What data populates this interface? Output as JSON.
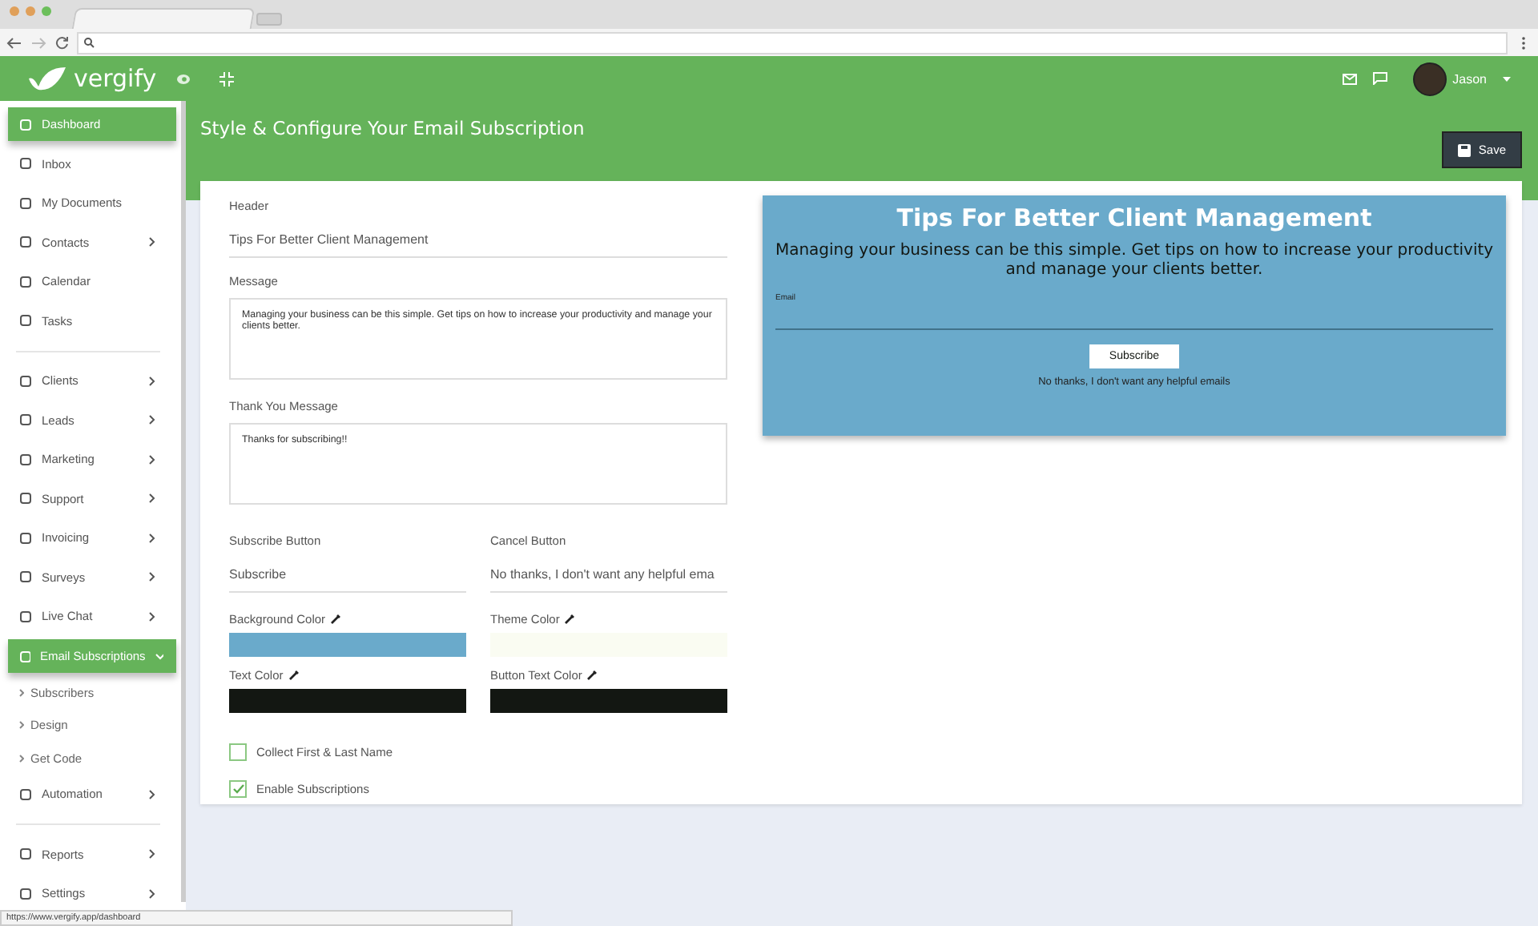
{
  "app": {
    "brand": "vergify",
    "user": "Jason"
  },
  "sidebar": {
    "sections": [
      {
        "items": [
          {
            "label": "Dashboard",
            "selected": true,
            "has_submenu": false
          },
          {
            "label": "Inbox",
            "selected": false,
            "has_submenu": false
          },
          {
            "label": "My Documents",
            "selected": false,
            "has_submenu": false
          },
          {
            "label": "Contacts",
            "selected": false,
            "has_submenu": true
          },
          {
            "label": "Calendar",
            "selected": false,
            "has_submenu": false
          },
          {
            "label": "Tasks",
            "selected": false,
            "has_submenu": false
          }
        ]
      },
      {
        "items": [
          {
            "label": "Clients",
            "selected": false,
            "has_submenu": true
          },
          {
            "label": "Leads",
            "selected": false,
            "has_submenu": true
          },
          {
            "label": "Marketing",
            "selected": false,
            "has_submenu": true
          },
          {
            "label": "Support",
            "selected": false,
            "has_submenu": true
          },
          {
            "label": "Invoicing",
            "selected": false,
            "has_submenu": true
          },
          {
            "label": "Surveys",
            "selected": false,
            "has_submenu": true
          },
          {
            "label": "Live Chat",
            "selected": false,
            "has_submenu": true
          },
          {
            "label": "Email Subscriptions",
            "selected": true,
            "has_submenu": true,
            "expanded": true,
            "children": [
              {
                "label": "Subscribers"
              },
              {
                "label": "Design"
              },
              {
                "label": "Get Code"
              }
            ]
          },
          {
            "label": "Automation",
            "selected": false,
            "has_submenu": true
          }
        ]
      },
      {
        "items": [
          {
            "label": "Reports",
            "selected": false,
            "has_submenu": true
          },
          {
            "label": "Settings",
            "selected": false,
            "has_submenu": true
          }
        ]
      }
    ]
  },
  "page": {
    "title": "Style & Configure Your Email Subscription",
    "save_button": "Save"
  },
  "form": {
    "header": {
      "label": "Header",
      "value": "Tips For Better Client Management"
    },
    "message": {
      "label": "Message",
      "value": "Managing your business can be this simple. Get tips on how to increase your productivity and manage your clients better."
    },
    "thank_you": {
      "label": "Thank You Message",
      "value": "Thanks for subscribing!!"
    },
    "buttons": [
      {
        "label": "Subscribe Button",
        "value": "Subscribe"
      },
      {
        "label": "Cancel Button",
        "value": "No thanks, I don't want any helpful ema"
      }
    ],
    "colors": [
      {
        "label": "Background Color",
        "color": "#6aaacb"
      },
      {
        "label": "Theme Color",
        "color": "#fafcf2"
      },
      {
        "label": "Text Color",
        "color": "#131712"
      },
      {
        "label": "Button Text Color",
        "color": "#131712"
      }
    ],
    "checkboxes": [
      {
        "label": "Collect First & Last Name",
        "checked": false
      },
      {
        "label": "Enable Subscriptions",
        "checked": true
      }
    ]
  },
  "preview": {
    "title": "Tips For Better Client Management",
    "message": "Managing your business can be this simple. Get tips on how to increase your productivity and manage your clients better.",
    "email_label": "Email",
    "subscribe_button": "Subscribe",
    "decline_link": "No thanks, I don't want any helpful emails"
  },
  "status_bar": {
    "url": "https://www.vergify.app/dashboard"
  }
}
